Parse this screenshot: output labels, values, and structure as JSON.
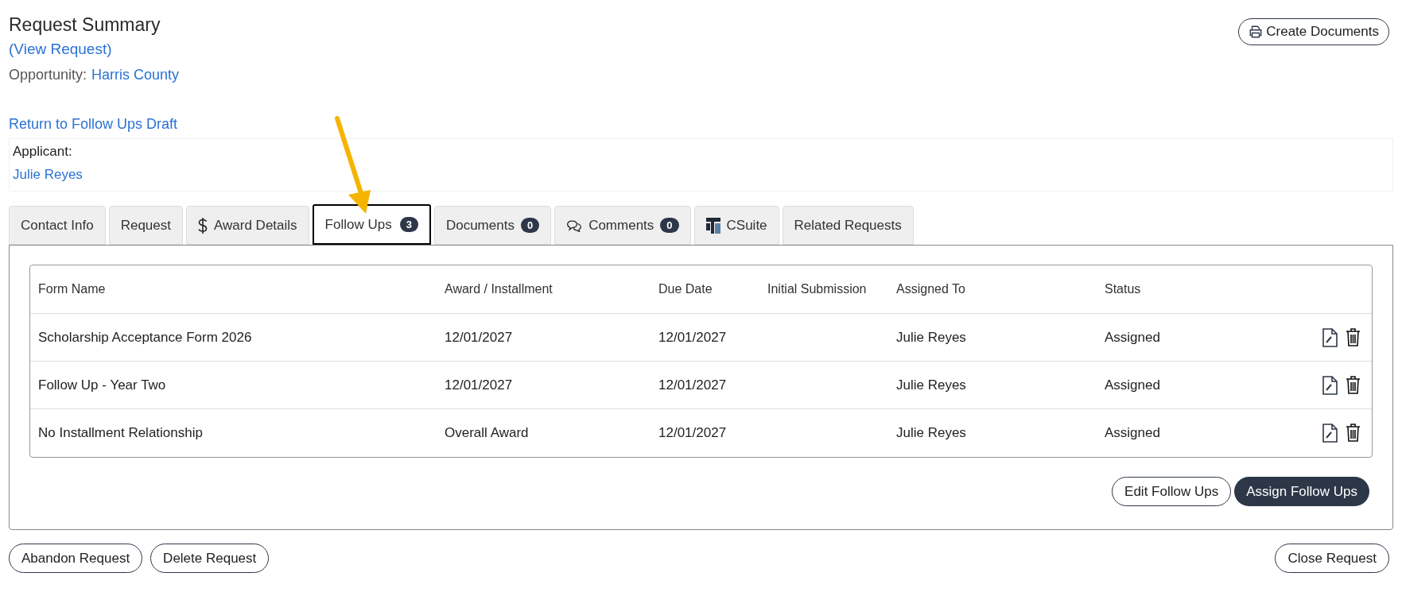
{
  "header": {
    "title": "Request Summary",
    "view_link": "(View Request)",
    "opportunity_label": "Opportunity:",
    "opportunity_link": "Harris County",
    "create_button": "Create Documents"
  },
  "return_link": "Return to Follow Ups Draft",
  "applicant": {
    "label": "Applicant:",
    "name": "Julie Reyes"
  },
  "tabs": [
    {
      "label": "Contact Info",
      "kind": "text",
      "selected": false
    },
    {
      "label": "Request",
      "kind": "text",
      "selected": false
    },
    {
      "label": "Award Details",
      "kind": "dollar",
      "selected": false
    },
    {
      "label": "Follow Ups",
      "kind": "text",
      "badge": "3",
      "selected": true
    },
    {
      "label": "Documents",
      "kind": "text",
      "badge": "0",
      "selected": false
    },
    {
      "label": "Comments",
      "kind": "comments",
      "badge": "0",
      "selected": false
    },
    {
      "label": "CSuite",
      "kind": "logo",
      "selected": false
    },
    {
      "label": "Related Requests",
      "kind": "text",
      "selected": false
    }
  ],
  "table": {
    "columns": [
      "Form Name",
      "Award / Installment",
      "Due Date",
      "Initial Submission",
      "Assigned To",
      "Status"
    ],
    "rows": [
      [
        "Scholarship Acceptance Form 2026",
        "12/01/2027",
        "12/01/2027",
        "",
        "Julie Reyes",
        "Assigned"
      ],
      [
        "Follow Up - Year Two",
        "12/01/2027",
        "12/01/2027",
        "",
        "Julie Reyes",
        "Assigned"
      ],
      [
        "No Installment Relationship",
        "Overall Award",
        "12/01/2027",
        "",
        "Julie Reyes",
        "Assigned"
      ]
    ]
  },
  "panel_buttons": [
    {
      "label": "Edit Follow Ups",
      "kind": "outline"
    },
    {
      "label": "Assign Follow Ups",
      "kind": "primary"
    }
  ],
  "footer": {
    "left_buttons": [
      "Abandon Request",
      "Delete Request"
    ],
    "right_button": "Close Request"
  }
}
